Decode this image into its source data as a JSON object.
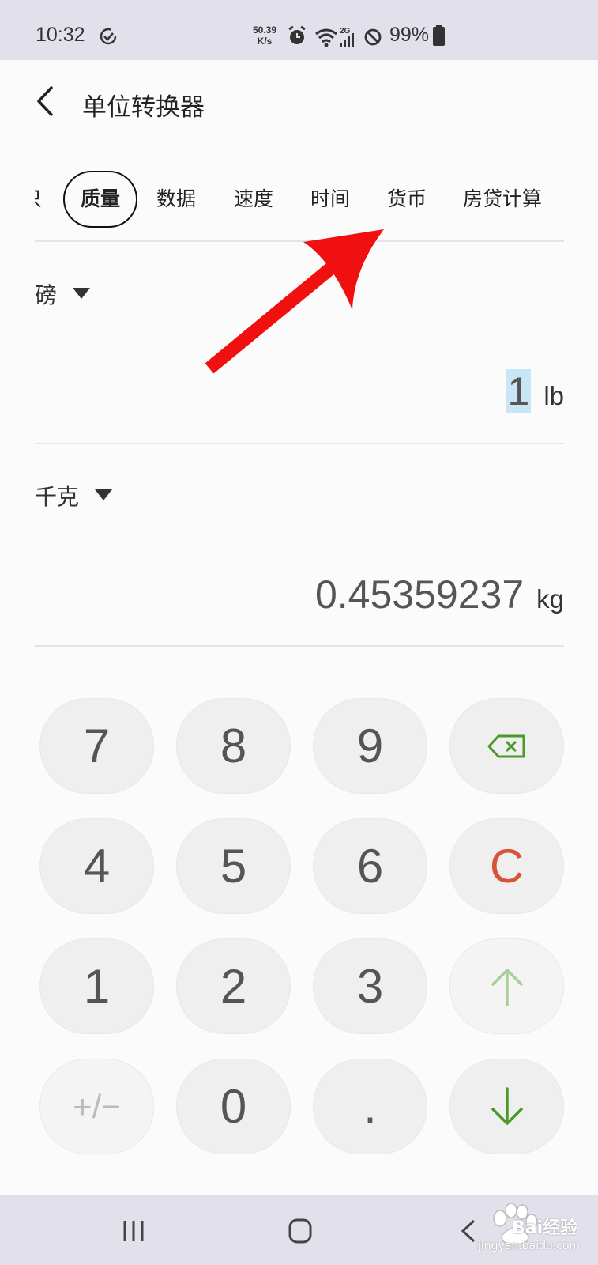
{
  "status_bar": {
    "time": "10:32",
    "speed_value": "50.39",
    "speed_unit": "K/s",
    "network": "2G",
    "battery": "99%"
  },
  "header": {
    "title": "单位转换器"
  },
  "tabs": [
    {
      "label": "只",
      "selected": false
    },
    {
      "label": "质量",
      "selected": true
    },
    {
      "label": "数据",
      "selected": false
    },
    {
      "label": "速度",
      "selected": false
    },
    {
      "label": "时间",
      "selected": false
    },
    {
      "label": "货币",
      "selected": false
    },
    {
      "label": "房贷计算",
      "selected": false
    }
  ],
  "from": {
    "unit_name": "磅",
    "value": "1",
    "unit_symbol": "lb"
  },
  "to": {
    "unit_name": "千克",
    "value": "0.45359237",
    "unit_symbol": "kg"
  },
  "keypad": {
    "k7": "7",
    "k8": "8",
    "k9": "9",
    "k4": "4",
    "k5": "5",
    "k6": "6",
    "k1": "1",
    "k2": "2",
    "k3": "3",
    "k_sign": "+/−",
    "k0": "0",
    "k_dot": ".",
    "k_clear": "C"
  },
  "colors": {
    "accent_green": "#4a9a2a",
    "clear_red": "#d9533a",
    "annotation_arrow": "#f01010"
  },
  "icons": {
    "back": "back-arrow-icon",
    "backspace": "backspace-icon",
    "up": "arrow-up-icon",
    "down": "arrow-down-icon"
  },
  "watermark": {
    "brand": "Bai经验",
    "site": "jingyan.baidu.com"
  }
}
